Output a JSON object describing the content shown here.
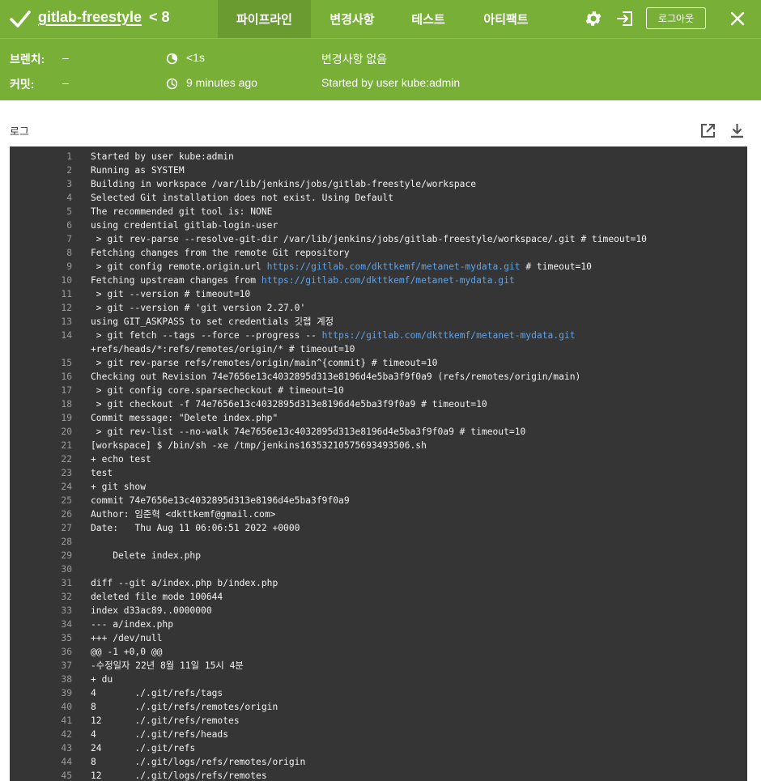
{
  "header": {
    "job_name": "gitlab-freestyle",
    "build_number": "< 8",
    "tabs": [
      {
        "label": "파이프라인",
        "active": true
      },
      {
        "label": "변경사항",
        "active": false
      },
      {
        "label": "테스트",
        "active": false
      },
      {
        "label": "아티팩트",
        "active": false
      }
    ],
    "logout_label": "로그아웃"
  },
  "info": {
    "branch_label": "브렌치:",
    "branch_value": "–",
    "commit_label": "커밋:",
    "commit_value": "–",
    "duration": "<1s",
    "time_ago": "9 minutes ago",
    "changes": "변경사항 없음",
    "started_by": "Started by user kube:admin"
  },
  "log": {
    "title": "로그",
    "lines": [
      {
        "n": "1",
        "t": "Started by user kube:admin"
      },
      {
        "n": "2",
        "t": "Running as SYSTEM"
      },
      {
        "n": "3",
        "t": "Building in workspace /var/lib/jenkins/jobs/gitlab-freestyle/workspace"
      },
      {
        "n": "4",
        "t": "Selected Git installation does not exist. Using Default"
      },
      {
        "n": "5",
        "t": "The recommended git tool is: NONE"
      },
      {
        "n": "6",
        "t": "using credential gitlab-login-user"
      },
      {
        "n": "7",
        "t": " > git rev-parse --resolve-git-dir /var/lib/jenkins/jobs/gitlab-freestyle/workspace/.git # timeout=10"
      },
      {
        "n": "8",
        "t": "Fetching changes from the remote Git repository"
      },
      {
        "n": "9",
        "t": " > git config remote.origin.url ",
        "link": "https://gitlab.com/dkttkemf/metanet-mydata.git",
        "after": " # timeout=10"
      },
      {
        "n": "10",
        "t": "Fetching upstream changes from ",
        "link": "https://gitlab.com/dkttkemf/metanet-mydata.git",
        "after": ""
      },
      {
        "n": "11",
        "t": " > git --version # timeout=10"
      },
      {
        "n": "12",
        "t": " > git --version # 'git version 2.27.0'"
      },
      {
        "n": "13",
        "t": "using GIT_ASKPASS to set credentials 깃랩 계정"
      },
      {
        "n": "14",
        "t": " > git fetch --tags --force --progress -- ",
        "link": "https://gitlab.com/dkttkemf/metanet-mydata.git",
        "after": ""
      },
      {
        "n": "",
        "t": "+refs/heads/*:refs/remotes/origin/* # timeout=10"
      },
      {
        "n": "15",
        "t": " > git rev-parse refs/remotes/origin/main^{commit} # timeout=10"
      },
      {
        "n": "16",
        "t": "Checking out Revision 74e7656e13c4032895d313e8196d4e5ba3f9f0a9 (refs/remotes/origin/main)"
      },
      {
        "n": "17",
        "t": " > git config core.sparsecheckout # timeout=10"
      },
      {
        "n": "18",
        "t": " > git checkout -f 74e7656e13c4032895d313e8196d4e5ba3f9f0a9 # timeout=10"
      },
      {
        "n": "19",
        "t": "Commit message: \"Delete index.php\""
      },
      {
        "n": "20",
        "t": " > git rev-list --no-walk 74e7656e13c4032895d313e8196d4e5ba3f9f0a9 # timeout=10"
      },
      {
        "n": "21",
        "t": "[workspace] $ /bin/sh -xe /tmp/jenkins16353210575693493506.sh"
      },
      {
        "n": "22",
        "t": "+ echo test"
      },
      {
        "n": "23",
        "t": "test"
      },
      {
        "n": "24",
        "t": "+ git show"
      },
      {
        "n": "25",
        "t": "commit 74e7656e13c4032895d313e8196d4e5ba3f9f0a9"
      },
      {
        "n": "26",
        "t": "Author: 임준혁 <dkttkemf@gmail.com>"
      },
      {
        "n": "27",
        "t": "Date:   Thu Aug 11 06:06:51 2022 +0000"
      },
      {
        "n": "28",
        "t": ""
      },
      {
        "n": "29",
        "t": "    Delete index.php"
      },
      {
        "n": "30",
        "t": ""
      },
      {
        "n": "31",
        "t": "diff --git a/index.php b/index.php"
      },
      {
        "n": "32",
        "t": "deleted file mode 100644"
      },
      {
        "n": "33",
        "t": "index d33ac89..0000000"
      },
      {
        "n": "34",
        "t": "--- a/index.php"
      },
      {
        "n": "35",
        "t": "+++ /dev/null"
      },
      {
        "n": "36",
        "t": "@@ -1 +0,0 @@"
      },
      {
        "n": "37",
        "t": "-수정일자 22년 8월 11일 15시 4분"
      },
      {
        "n": "38",
        "t": "+ du"
      },
      {
        "n": "39",
        "t": "4       ./.git/refs/tags"
      },
      {
        "n": "40",
        "t": "8       ./.git/refs/remotes/origin"
      },
      {
        "n": "41",
        "t": "12      ./.git/refs/remotes"
      },
      {
        "n": "42",
        "t": "4       ./.git/refs/heads"
      },
      {
        "n": "43",
        "t": "24      ./.git/refs"
      },
      {
        "n": "44",
        "t": "8       ./.git/logs/refs/remotes/origin"
      },
      {
        "n": "45",
        "t": "12      ./.git/logs/refs/remotes"
      }
    ]
  }
}
